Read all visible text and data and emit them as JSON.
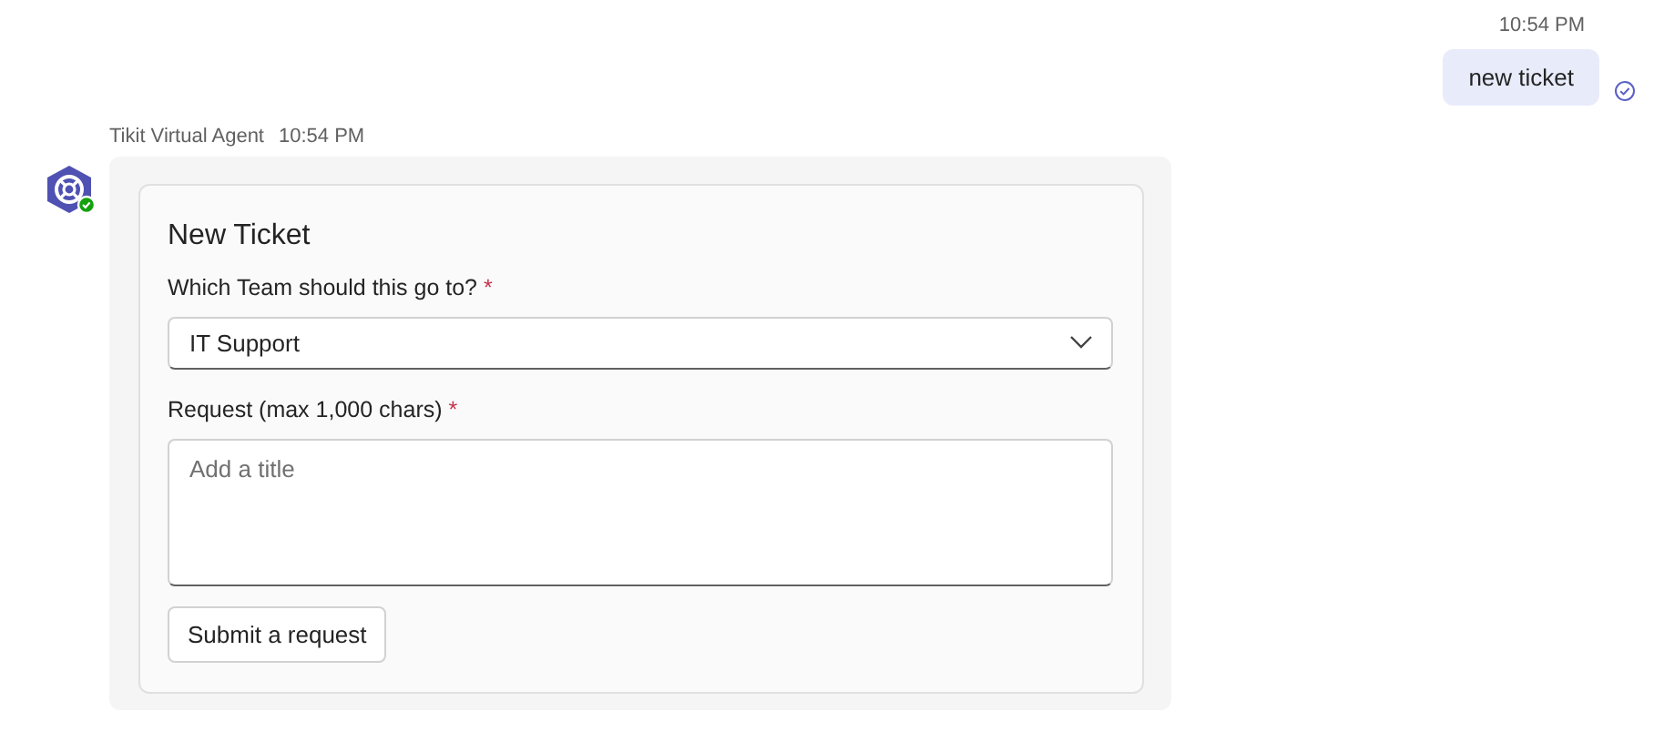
{
  "sent_message": {
    "time": "10:54 PM",
    "text": "new ticket"
  },
  "bot_message": {
    "sender": "Tikit Virtual Agent",
    "time": "10:54 PM",
    "card": {
      "title": "New Ticket",
      "fields": [
        {
          "kind": "dropdown",
          "label": "Which Team should this go to?",
          "required_mark": "*",
          "value": "IT Support"
        },
        {
          "kind": "textarea",
          "label": "Request (max 1,000 chars)",
          "required_mark": "*",
          "placeholder": "Add a title"
        }
      ],
      "button": "Submit a request"
    }
  }
}
